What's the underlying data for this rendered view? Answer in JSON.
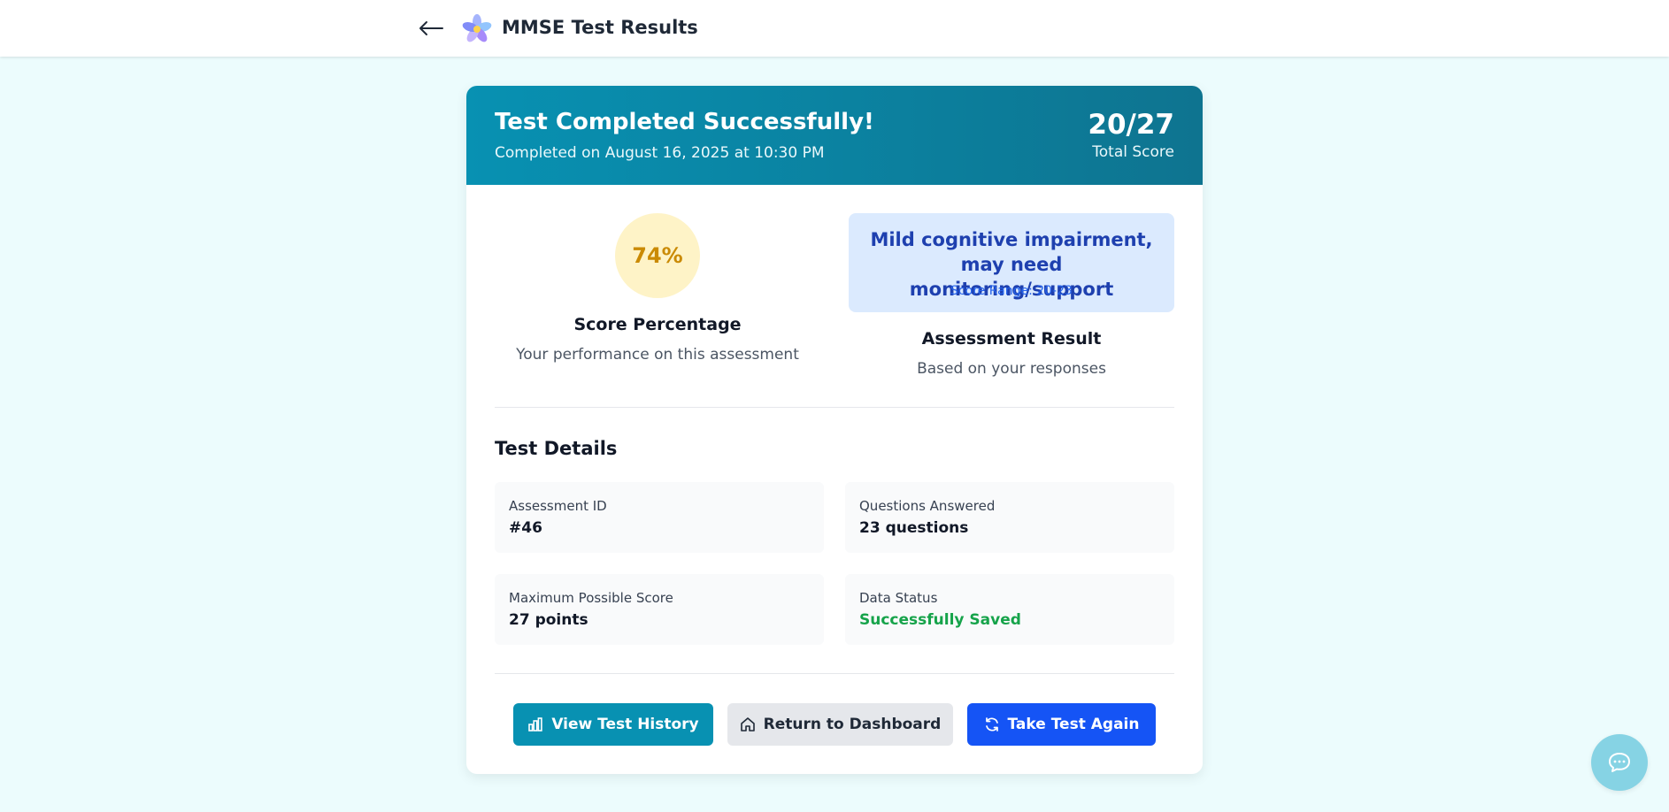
{
  "header": {
    "back_icon": "arrow-left-icon",
    "logo_icon": "flower-logo",
    "title": "MMSE Test Results"
  },
  "result_card": {
    "title": "Test Completed Successfully!",
    "completed_on": "Completed on August 16, 2025 at 10:30 PM",
    "score": "20/27",
    "score_label": "Total Score",
    "percentage": "74%",
    "percentage_title": "Score Percentage",
    "percentage_subtitle": "Your performance on this assessment",
    "assessment_text": "Mild cognitive impairment, may need monitoring/support",
    "score_range": "Score Range: 20-23",
    "assessment_title": "Assessment Result",
    "assessment_subtitle": "Based on your responses"
  },
  "details": {
    "title": "Test Details",
    "items": [
      {
        "label": "Assessment ID",
        "value": "#46"
      },
      {
        "label": "Questions Answered",
        "value": "23 questions"
      },
      {
        "label": "Maximum Possible Score",
        "value": "27 points"
      },
      {
        "label": "Data Status",
        "value": "Successfully Saved"
      }
    ]
  },
  "actions": {
    "history": "View Test History",
    "dashboard": "Return to Dashboard",
    "again": "Take Test Again"
  },
  "colors": {
    "page_bg": "#ecfcfd",
    "header_gradient_start": "#0891b2",
    "header_gradient_end": "#0e7490",
    "percentage_bg": "#fef3c7",
    "percentage_text": "#ca8a04",
    "assessment_bg": "#dbeafe",
    "assessment_text": "#1e40af",
    "success_green": "#16a34a",
    "primary_blue": "#1554f5"
  },
  "chat": {
    "icon": "chat-bubble-icon"
  }
}
